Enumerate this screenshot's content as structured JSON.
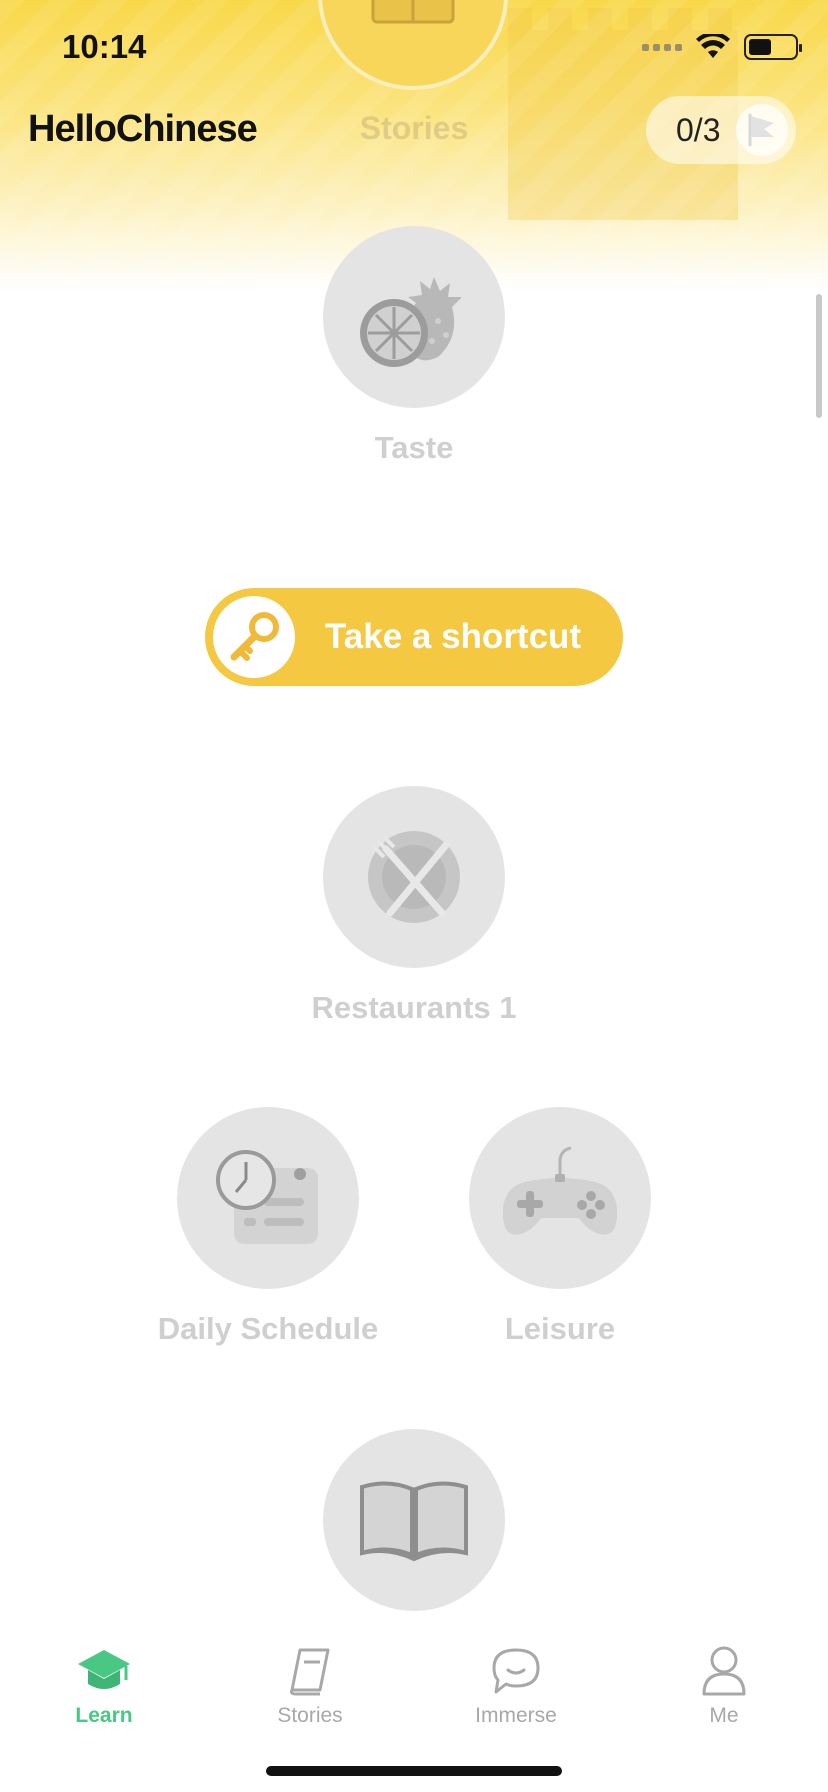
{
  "status_bar": {
    "time": "10:14"
  },
  "header": {
    "logo": "HelloChinese",
    "section_label": "Stories",
    "progress": "0/3"
  },
  "lessons": {
    "taste": "Taste",
    "restaurants": "Restaurants 1",
    "daily_schedule": "Daily Schedule",
    "leisure": "Leisure"
  },
  "shortcut": {
    "label": "Take a shortcut"
  },
  "bottom_nav": {
    "items": [
      {
        "label": "Learn",
        "icon": "graduation-cap-icon",
        "active": true
      },
      {
        "label": "Stories",
        "icon": "book-icon",
        "active": false
      },
      {
        "label": "Immerse",
        "icon": "chat-bubble-icon",
        "active": false
      },
      {
        "label": "Me",
        "icon": "person-icon",
        "active": false
      }
    ]
  },
  "colors": {
    "accent_yellow": "#f5c842",
    "active_green": "#49c884",
    "locked_gray": "#e4e4e4"
  }
}
